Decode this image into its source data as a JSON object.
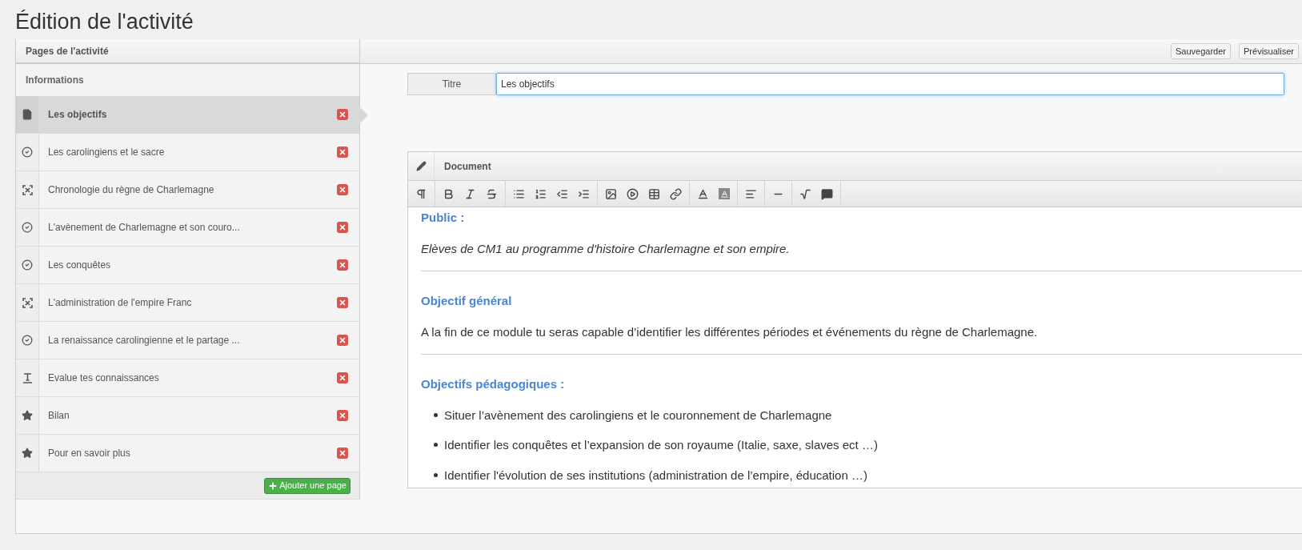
{
  "page_title": "Édition de l'activité",
  "sidebar": {
    "header": "Pages de l'activité",
    "section": "Informations",
    "items": [
      {
        "label": "Les objectifs",
        "kind": "document",
        "selected": true
      },
      {
        "label": "Les carolingiens et le sacre",
        "kind": "quiz",
        "selected": false
      },
      {
        "label": "Chronologie du règne de Charlemagne",
        "kind": "frame",
        "selected": false
      },
      {
        "label": "L'avènement de Charlemagne et son couro...",
        "kind": "quiz",
        "selected": false
      },
      {
        "label": "Les conquêtes",
        "kind": "quiz",
        "selected": false
      },
      {
        "label": "L'administration de l'empire Franc",
        "kind": "frame",
        "selected": false
      },
      {
        "label": "La renaissance carolingienne et le partage ...",
        "kind": "quiz",
        "selected": false
      },
      {
        "label": "Evalue tes connaissances",
        "kind": "text",
        "selected": false
      },
      {
        "label": "Bilan",
        "kind": "star",
        "selected": false
      },
      {
        "label": "Pour en savoir plus",
        "kind": "star",
        "selected": false
      }
    ],
    "add_button": "Ajouter une page"
  },
  "toolbar": {
    "buttons": [
      "Sauvegarder",
      "Prévisualiser"
    ]
  },
  "title_field": {
    "label": "Titre",
    "value": "Les objectifs"
  },
  "editor": {
    "header": "Document",
    "content": [
      {
        "kind": "heading",
        "text": "Public :"
      },
      {
        "kind": "italic",
        "text": "Elèves de CM1 au programme d'histoire Charlemagne et son empire."
      },
      {
        "kind": "rule"
      },
      {
        "kind": "heading",
        "text": "Objectif général"
      },
      {
        "kind": "paragraph",
        "text": "A la fin de ce module tu seras capable d’identifier les différentes périodes et événements du règne de Charlemagne."
      },
      {
        "kind": "rule"
      },
      {
        "kind": "heading",
        "text": "Objectifs pédagogiques :"
      },
      {
        "kind": "bullet",
        "text": "Situer l’avènement des carolingiens et le couronnement de Charlemagne"
      },
      {
        "kind": "bullet",
        "text": "Identifier les conquêtes et l’expansion de son royaume (Italie, saxe, slaves ect …)"
      },
      {
        "kind": "bullet",
        "text": "Identifier l'évolution de ses institutions (administration de l’empire, éducation …)"
      }
    ]
  }
}
